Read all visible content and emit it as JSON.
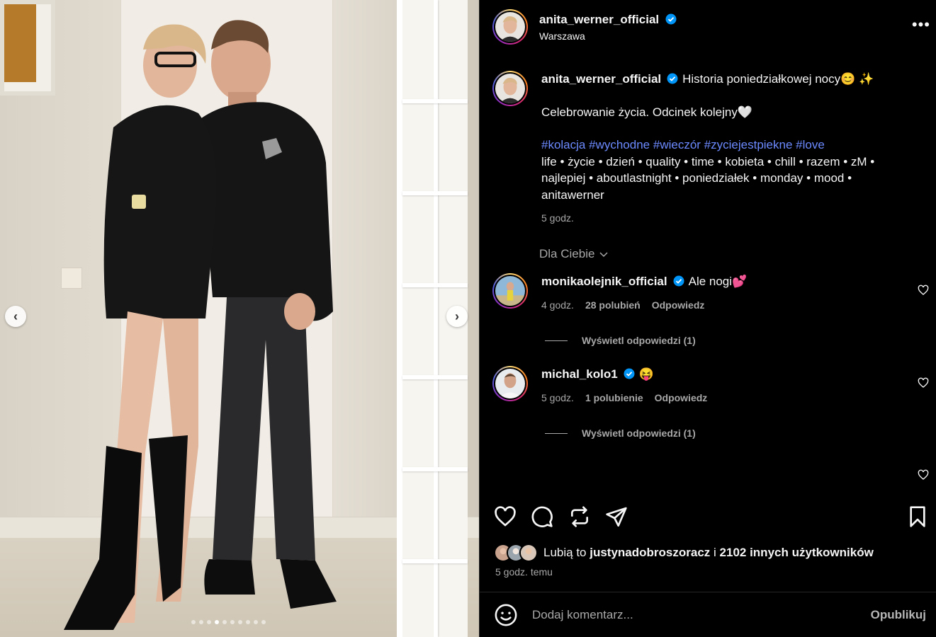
{
  "post": {
    "author": "anita_werner_official",
    "location": "Warszawa",
    "caption_line1": "Historia poniedziałkowej nocy😊 ✨",
    "caption_line2": "Celebrowanie życia. Odcinek kolejny🤍",
    "hashtags": [
      "#kolacja",
      "#wychodne",
      "#wieczór",
      "#zyciejestpiekne",
      "#love"
    ],
    "tags_text": "life • życie • dzień • quality • time • kobieta • chill • razem • zM • najlepiej • aboutlastnight • poniedziałek • monday • mood • anitawerner",
    "caption_time": "5 godz.",
    "media_dots_total": 10,
    "media_dots_active": 3
  },
  "sort_label": "Dla Ciebie",
  "comments": [
    {
      "user": "monikaolejnik_official",
      "text": "Ale nogi💕",
      "time": "4 godz.",
      "likes": "28 polubień",
      "reply": "Odpowiedz",
      "view_replies": "Wyświetl odpowiedzi (1)"
    },
    {
      "user": "michal_kolo1",
      "text": "😝",
      "time": "5 godz.",
      "likes": "1 polubienie",
      "reply": "Odpowiedz",
      "view_replies": "Wyświetl odpowiedzi (1)"
    }
  ],
  "likes_line": {
    "prefix": "Lubią to",
    "user": "justynadobroszoracz",
    "conj": "i",
    "others": "2102 innych użytkowników"
  },
  "posted_ago": "5 godz. temu",
  "add_comment": {
    "placeholder": "Dodaj komentarz...",
    "publish_label": "Opublikuj"
  },
  "icons": {
    "verified": "verified-badge-icon",
    "more": "more-options-icon",
    "like": "heart-icon",
    "comment": "comment-bubble-icon",
    "share": "repost-icon",
    "send": "send-icon",
    "save": "bookmark-icon",
    "emoji": "emoji-icon",
    "chevron": "chevron-down-icon"
  },
  "colors": {
    "background": "#000000",
    "text": "#f5f5f5",
    "muted": "#a8a8a8",
    "hashtag": "#6c8aff",
    "verified": "#0095f6"
  }
}
